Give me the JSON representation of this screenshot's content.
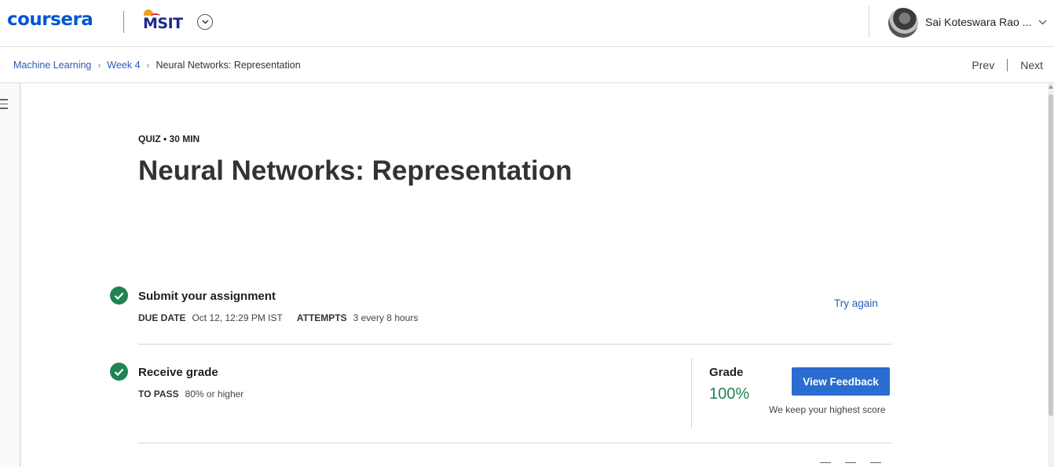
{
  "header": {
    "brand": "coursera",
    "org_logo": "MSIT",
    "org_dropdown_icon": "chevron-down-icon",
    "user_name": "Sai Koteswara Rao ...",
    "user_menu_icon": "chevron-down-icon"
  },
  "breadcrumb": {
    "items": [
      "Machine Learning",
      "Week 4"
    ],
    "current": "Neural Networks: Representation",
    "separator": "›"
  },
  "nav": {
    "prev": "Prev",
    "next": "Next"
  },
  "quiz": {
    "eyebrow": "QUIZ • 30 MIN",
    "title": "Neural Networks: Representation"
  },
  "submit": {
    "title": "Submit your assignment",
    "due_label": "DUE DATE",
    "due_value": "Oct 12, 12:29 PM IST",
    "attempts_label": "ATTEMPTS",
    "attempts_value": "3 every 8 hours",
    "action": "Try again"
  },
  "receive": {
    "title": "Receive grade",
    "pass_label": "TO PASS",
    "pass_value": "80% or higher",
    "grade_label": "Grade",
    "grade_value": "100%",
    "feedback_button": "View Feedback",
    "note": "We keep your highest score"
  },
  "colors": {
    "brand_blue": "#0056d2",
    "link_blue": "#2a5bb8",
    "button_blue": "#2a6ccf",
    "success_green": "#1f8354"
  }
}
